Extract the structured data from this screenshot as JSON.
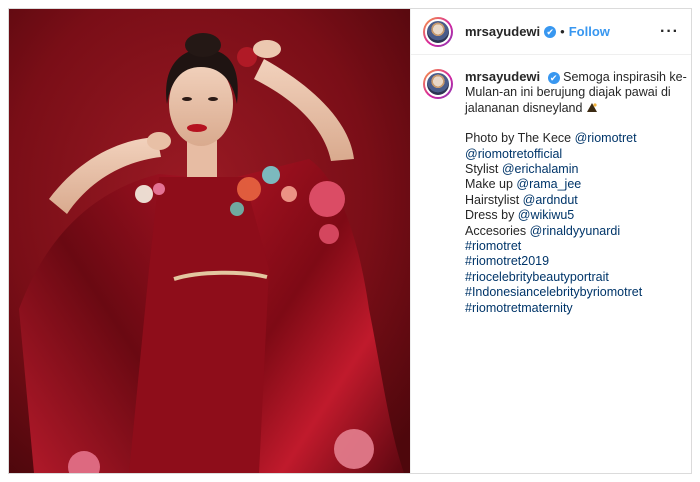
{
  "post": {
    "username": "mrsayudewi",
    "verified_mark": "✔",
    "separator": "•",
    "follow_label": "Follow",
    "more_label": "···"
  },
  "caption": {
    "username": "mrsayudewi",
    "intro_1": "Semoga inspirasih ke-",
    "intro_2": "Mulan-an ini berujung diajak pawai di",
    "intro_3": "jalananan disneyland",
    "emoji": "sparkle-icon",
    "credits": [
      {
        "label": "Photo by The Kece ",
        "link": "@riomotret"
      },
      {
        "label": "",
        "link": "@riomotretofficial"
      },
      {
        "label": "Stylist ",
        "link": "@erichalamin"
      },
      {
        "label": "Make up ",
        "link": "@rama_jee"
      },
      {
        "label": "Hairstylist ",
        "link": "@ardndut"
      },
      {
        "label": "Dress by ",
        "link": "@wikiwu5"
      },
      {
        "label": "Accesories ",
        "link": "@rinaldyyunardi"
      }
    ],
    "hashtags": [
      "#riomotret",
      "#riomotret2019",
      "#riocelebritybeautyportrait",
      "#Indonesiancelebritybyriomotret",
      "#riomotretmaternity"
    ]
  },
  "colors": {
    "background_red": "#7d0f18",
    "dress_red": "#9c0f1c",
    "link_blue": "#003569",
    "follow_blue": "#3897f0"
  }
}
